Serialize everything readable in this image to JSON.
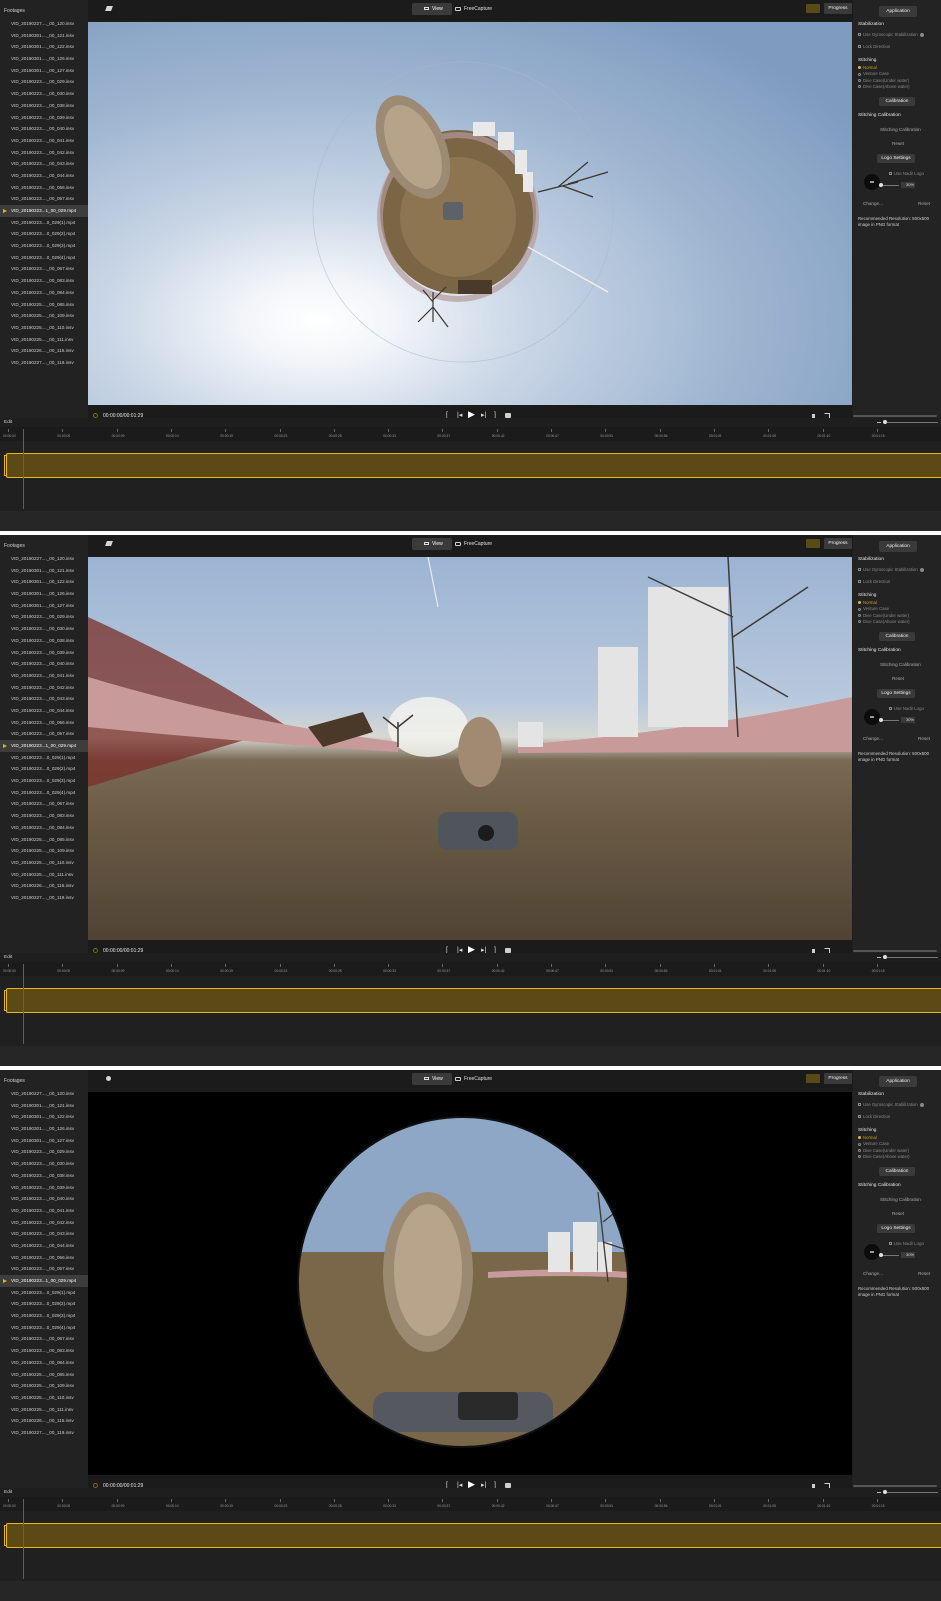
{
  "footage_panel": {
    "title": "Footages",
    "items": [
      "VID_20190227...._00_120.insv",
      "VID_20190301...._00_121.insv",
      "VID_20190301...._00_122.insv",
      "VID_20190301...._00_126.insv",
      "VID_20190301...._00_127.insv",
      "VID_20190223...._00_029.insv",
      "VID_20190223...._00_030.insv",
      "VID_20190223...._00_038.insv",
      "VID_20190223...._00_039.insv",
      "VID_20190223...._00_040.insv",
      "VID_20190223...._00_041.insv",
      "VID_20190223...._00_042.insv",
      "VID_20190223...._00_043.insv",
      "VID_20190223...._00_044.insv",
      "VID_20190223...._00_056.insv",
      "VID_20190223...._00_057.insv",
      "VID_20190223...1_00_029.mp4",
      "VID_20190223....0_029(1).mp4",
      "VID_20190223....0_029(2).mp4",
      "VID_20190223....0_029(3).mp4",
      "VID_20190223....0_029(4).mp4",
      "VID_20190223...._00_067.insv",
      "VID_20190223...._00_083.insv",
      "VID_20190223...._00_084.insv",
      "VID_20190225...._00_085.insv",
      "VID_20190225...._00_109.insv",
      "VID_20190225...._00_110.insv",
      "VID_20190225...._00_111.insv",
      "VID_20190226...._00_115.insv",
      "VID_20190227...._00_119.insv"
    ],
    "selected_index": 16
  },
  "topbar": {
    "view_tab": "View",
    "freecapture_tab": "FreeCapture",
    "progress_button": "Progress"
  },
  "player": {
    "timecode": "00:00:00/00:01:29"
  },
  "settings": {
    "application_button": "Application",
    "stabilization_title": "Stabilization",
    "use_gyro": "Use Gyroscopic Stabilization",
    "lock_direction": "Lock Direction",
    "stitching_title": "Stitching",
    "stitch_options": [
      "Normal",
      "Venture Case",
      "Dive Case(Under water)",
      "Dive Case(Above water)"
    ],
    "selected_stitch": 0,
    "calibration_button": "Calibration",
    "stitching_calibration_title": "Stitching Calibration",
    "stitching_calibration_link": "Stitching Calibration",
    "reset_link": "Reset",
    "logo_settings_button": "Logo Settings",
    "use_nadir_logo": "Use Nadir Logo",
    "nadir_percent": "30%",
    "change_link": "Change...",
    "reset_logo_link": "Reset",
    "recommended_note": "Recommended Resolution: 500x500 image in PNG format"
  },
  "timeline": {
    "edit_label": "Edit",
    "ruler_labels": [
      "00:00:00",
      "00:00:05",
      "00:00:09",
      "00:00:14",
      "00:00:19",
      "00:00:23",
      "00:00:28",
      "00:00:33",
      "00:00:37",
      "00:00:42",
      "00:00:47",
      "00:00:51",
      "00:00:56",
      "00:01:01",
      "00:01:05",
      "00:01:10",
      "00:01:15"
    ]
  },
  "screens": [
    {
      "name": "tiny-planet",
      "view_mode": "tiny planet"
    },
    {
      "name": "wide-angle",
      "view_mode": "wide angle"
    },
    {
      "name": "fisheye",
      "view_mode": "fisheye"
    }
  ],
  "colors": {
    "accent": "#e2b714",
    "clip_fill": "#5b4a16",
    "panel_bg": "#222222",
    "app_bg": "#1e1e1e"
  }
}
